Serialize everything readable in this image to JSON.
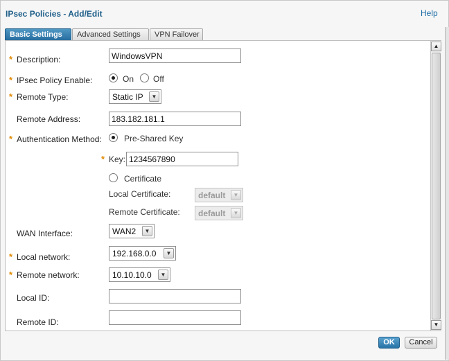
{
  "header": {
    "title": "IPsec Policies - Add/Edit",
    "help_label": "Help"
  },
  "tabs": [
    {
      "label": "Basic Settings",
      "active": true
    },
    {
      "label": "Advanced Settings",
      "active": false
    },
    {
      "label": "VPN Failover",
      "active": false
    }
  ],
  "form": {
    "required_marker": "*",
    "description": {
      "label": "Description:",
      "value": "WindowsVPN"
    },
    "policy_enable": {
      "label": "IPsec Policy Enable:",
      "on_label": "On",
      "off_label": "Off",
      "selected": "On"
    },
    "remote_type": {
      "label": "Remote Type:",
      "value": "Static IP"
    },
    "remote_address": {
      "label": "Remote Address:",
      "value": "183.182.181.1"
    },
    "auth_method": {
      "label": "Authentication Method:",
      "psk_label": "Pre-Shared Key",
      "key_label": "Key:",
      "key_value": "1234567890",
      "certificate_label": "Certificate",
      "local_cert_label": "Local Certificate:",
      "local_cert_value": "default",
      "remote_cert_label": "Remote Certificate:",
      "remote_cert_value": "default",
      "selected": "Pre-Shared Key"
    },
    "wan_interface": {
      "label": "WAN Interface:",
      "value": "WAN2"
    },
    "local_network": {
      "label": "Local network:",
      "value": "192.168.0.0"
    },
    "remote_network": {
      "label": "Remote network:",
      "value": "10.10.10.0"
    },
    "local_id": {
      "label": "Local ID:",
      "value": ""
    },
    "remote_id": {
      "label": "Remote ID:",
      "value": ""
    }
  },
  "footer": {
    "ok_label": "OK",
    "cancel_label": "Cancel"
  },
  "icons": {
    "select_arrow": "chevron-down-icon",
    "scroll_up": "arrow-up-icon",
    "scroll_down": "arrow-down-icon"
  },
  "colors": {
    "title": "#1f5f8a",
    "accent": "#2773a6",
    "required": "#e08a00"
  }
}
